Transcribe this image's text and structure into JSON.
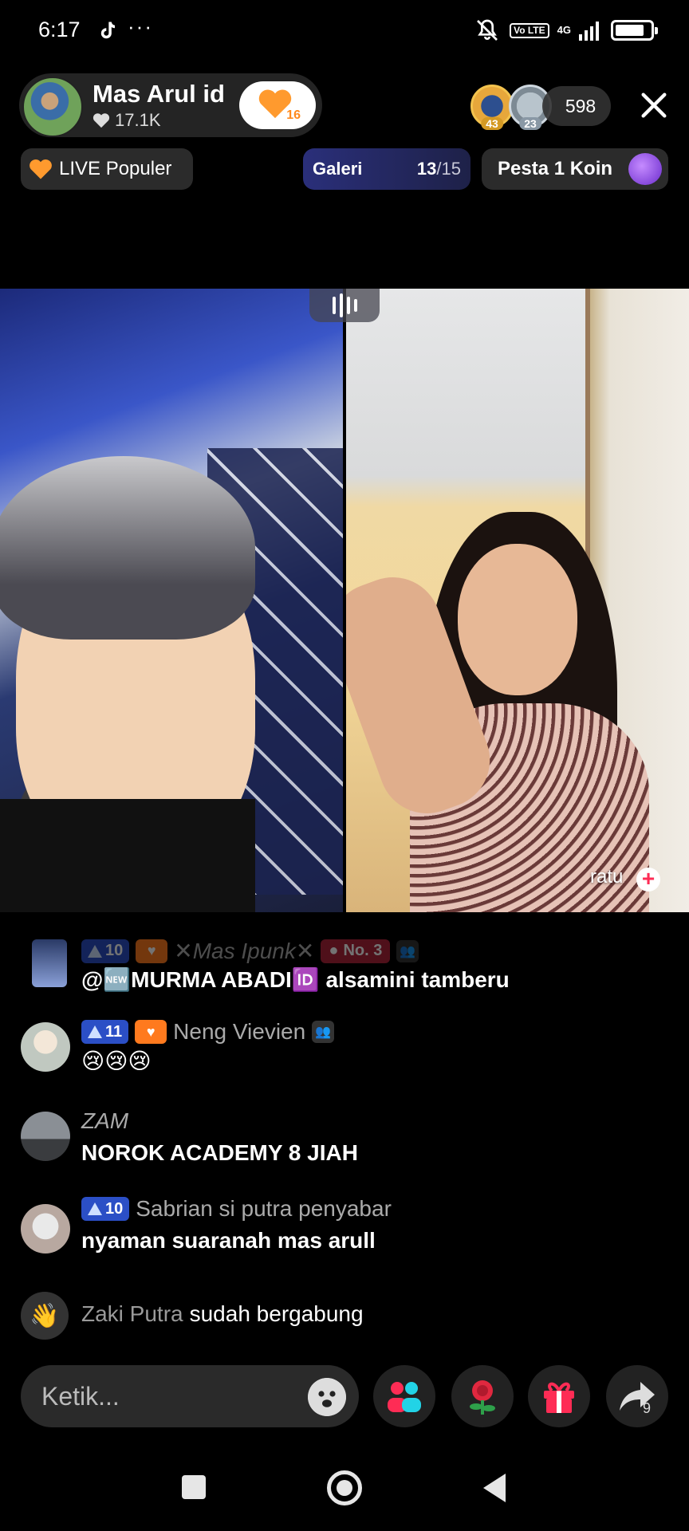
{
  "status_bar": {
    "time": "6:17",
    "dots": "···",
    "volte": "Vo\nLTE",
    "network": "4G",
    "battery_level": 0.85
  },
  "host": {
    "name": "Mas Arul id",
    "likes": "17.1K",
    "fan_level": "16"
  },
  "top_viewers": [
    {
      "rank": "43"
    },
    {
      "rank": "23"
    }
  ],
  "viewer_count": "598",
  "badges": {
    "live_popular": "LIVE Populer",
    "gallery_label": "Galeri",
    "gallery_current": "13",
    "gallery_total": "/15",
    "party_label": "Pesta 1 Koin"
  },
  "guest": {
    "name": "ratu",
    "plus": "+"
  },
  "chat": [
    {
      "level": "10",
      "name": "✕Mas Ipunk✕",
      "rank_badge": "No. 3",
      "text": "@🆕MURMA ABADI🆔 alsamini tamberu"
    },
    {
      "level": "11",
      "name": "Neng Vievien",
      "text": "😢😢😢"
    },
    {
      "name": "ZAM",
      "text": "NOROK ACADEMY 8 JIAH"
    },
    {
      "level": "10",
      "name": "Sabrian si putra penyabar",
      "text": "nyaman suaranah mas arull"
    },
    {
      "name": "Zaki Putra",
      "text": "sudah bergabung"
    }
  ],
  "input": {
    "placeholder": "Ketik..."
  },
  "share_count": "9",
  "colors": {
    "accent_pink": "#fe2c55",
    "level_blue": "#2b4fc6",
    "fan_orange": "#ff7a1e",
    "gallery_bg": "#2a2f7a"
  },
  "icons": [
    "tiktok-icon",
    "mute-icon",
    "heart-icon",
    "close-icon",
    "fire-heart-icon",
    "emoji-icon",
    "multi-guest-icon",
    "rose-icon",
    "gift-icon",
    "share-icon",
    "wave-hand-icon"
  ]
}
